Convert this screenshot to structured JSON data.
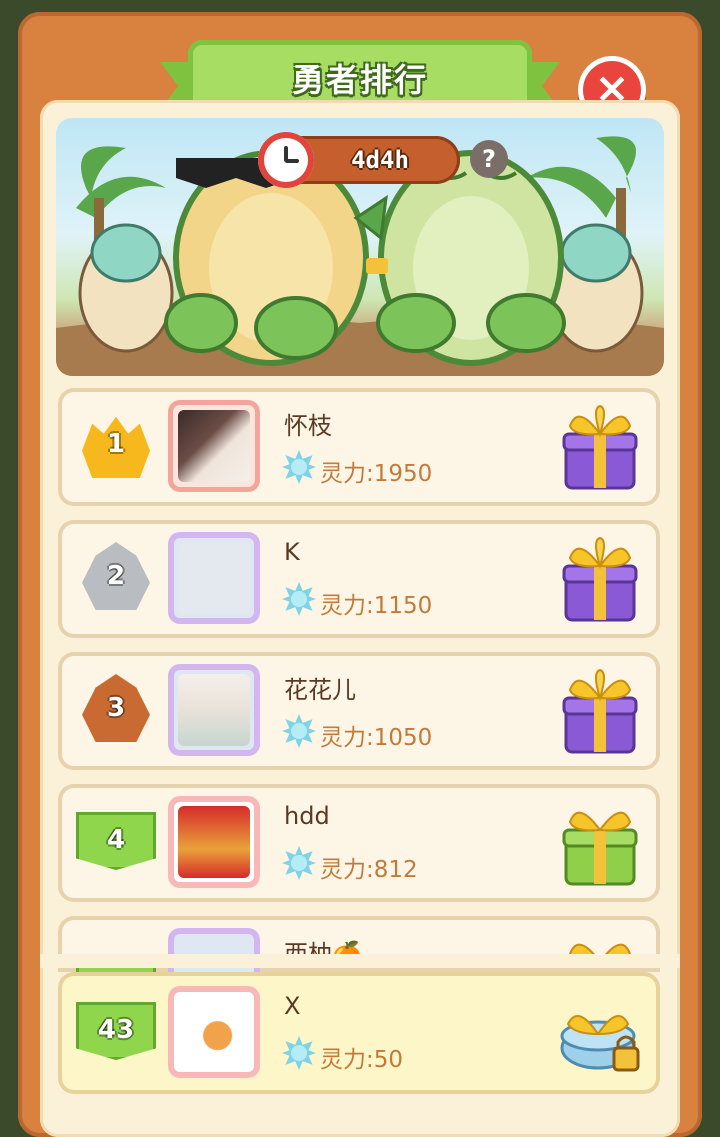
{
  "title": "勇者排行",
  "timer": "4d4h",
  "help_label": "?",
  "close_label": "×",
  "power_label": "灵力:",
  "rows": [
    {
      "rank": "1",
      "name": "怀枝",
      "power": "灵力:1950",
      "badge": "gold",
      "avatar": "pink-photo",
      "gift": "purple-gift"
    },
    {
      "rank": "2",
      "name": "K",
      "power": "灵力:1150",
      "badge": "silver",
      "avatar": "unicorn-frame",
      "gift": "purple-gift"
    },
    {
      "rank": "3",
      "name": "花花儿",
      "power": "灵力:1050",
      "badge": "bronze",
      "avatar": "unicorn-frame",
      "gift": "purple-gift"
    },
    {
      "rank": "4",
      "name": "hdd",
      "power": "灵力:812",
      "badge": "green",
      "avatar": "cat-frame",
      "gift": "green-gift"
    },
    {
      "rank": "",
      "name": "西柚🍊",
      "power": "",
      "badge": "green",
      "avatar": "unicorn-frame",
      "gift": "yellow-gift"
    }
  ],
  "self": {
    "rank": "43",
    "name": "X",
    "power": "灵力:50",
    "badge": "green",
    "avatar": "cat-frame",
    "gift": "locked-blue-gift"
  },
  "colors": {
    "frame": "#d9823f",
    "panel": "#fbf1d9",
    "title_green": "#a6dd62",
    "close_red": "#e9443d",
    "power_text": "#c27a3a"
  }
}
